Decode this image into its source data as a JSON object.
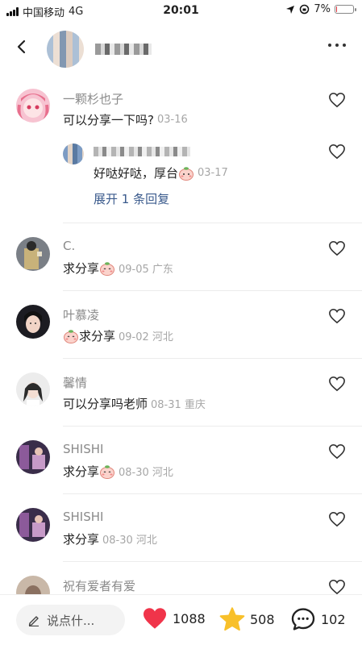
{
  "status_bar": {
    "carrier": "中国移动",
    "network": "4G",
    "time": "20:01",
    "battery": "7%",
    "battery_level": 0.07
  },
  "colors": {
    "link": "#3a5a8c",
    "like_red": "#f0344a",
    "star_yellow": "#f8c02a"
  },
  "comments": [
    {
      "name": "一颗杉也子",
      "text": "可以分享一下吗?",
      "meta": "03-16",
      "avatar_icon": "anime-girl-avatar",
      "reply": {
        "text": "好哒好哒，厚台",
        "meta": "03-17",
        "emoji": "peach-emoji"
      },
      "expand_label": "展开 1 条回复"
    },
    {
      "name": "C.",
      "text": "求分享",
      "emoji": "peach-emoji",
      "meta": "09-05 广东"
    },
    {
      "name": "叶慕凌",
      "text": "求分享",
      "emoji": "peach-emoji",
      "meta": "09-02 河北"
    },
    {
      "name": "馨情",
      "text": "可以分享吗老师",
      "meta": "08-31 重庆"
    },
    {
      "name": "SHISHI",
      "text": "求分享",
      "emoji": "peach-emoji",
      "meta": "08-30 河北"
    },
    {
      "name": "SHISHI",
      "text": "求分享",
      "meta": "08-30 河北"
    },
    {
      "name": "祝有爱者有爱"
    }
  ],
  "bottom_bar": {
    "input_placeholder": "说点什...",
    "like_count": "1088",
    "collect_count": "508",
    "comment_count": "102"
  }
}
